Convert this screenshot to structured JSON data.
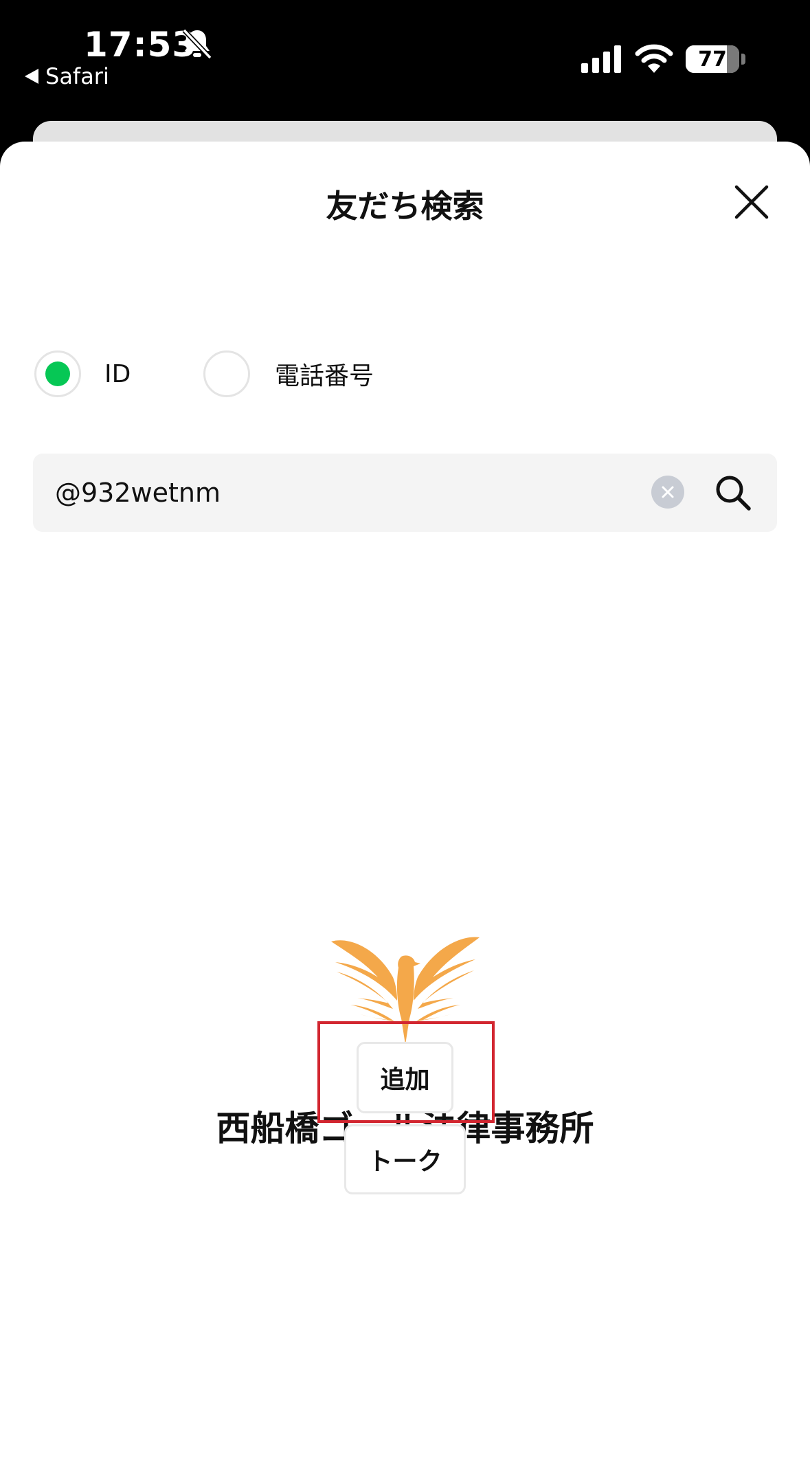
{
  "status_bar": {
    "time": "17:53",
    "back_label": "Safari",
    "battery_level": "77",
    "battery_fraction": 0.77
  },
  "sheet": {
    "title": "友だち検索"
  },
  "search_type": {
    "options": [
      {
        "label": "ID",
        "selected": true
      },
      {
        "label": "電話番号",
        "selected": false
      }
    ]
  },
  "search": {
    "value": "@932wetnm"
  },
  "result": {
    "account_name": "西船橋ゴール法律事務所",
    "add_label": "追加",
    "talk_label": "トーク"
  },
  "colors": {
    "accent_green": "#06c755",
    "logo_orange": "#f4a84a",
    "highlight_red": "#d22630"
  },
  "icons": {
    "bell": "bell-slash-icon",
    "signal": "cellular-signal-icon",
    "wifi": "wifi-icon",
    "close": "close-icon",
    "clear": "clear-icon",
    "search": "search-icon",
    "logo": "phoenix-logo-icon"
  }
}
